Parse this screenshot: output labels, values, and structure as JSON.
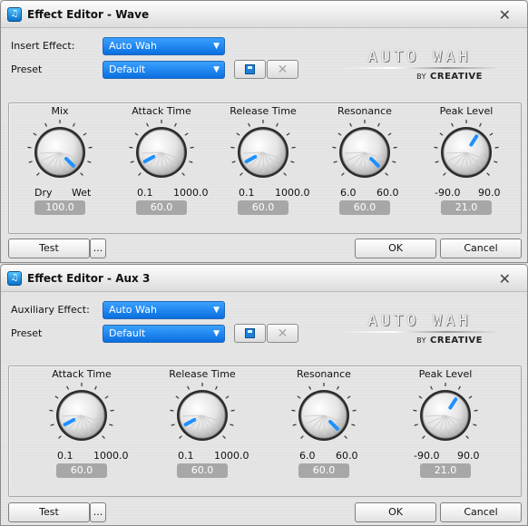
{
  "windows": [
    {
      "title": "Effect Editor - Wave",
      "effect_label": "Insert Effect:",
      "effect_value": "Auto Wah",
      "preset_label": "Preset",
      "preset_value": "Default",
      "logo": {
        "main": "AUTO WAH",
        "by": "BY",
        "brand": "CREATIVE"
      },
      "knobs": [
        {
          "label": "Mix",
          "min": "Dry",
          "max": "Wet",
          "value": "100.0",
          "fraction": 1.0
        },
        {
          "label": "Attack Time",
          "min": "0.1",
          "max": "1000.0",
          "value": "60.0",
          "fraction": 0.06
        },
        {
          "label": "Release Time",
          "min": "0.1",
          "max": "1000.0",
          "value": "60.0",
          "fraction": 0.06
        },
        {
          "label": "Resonance",
          "min": "6.0",
          "max": "60.0",
          "value": "60.0",
          "fraction": 1.0
        },
        {
          "label": "Peak Level",
          "min": "-90.0",
          "max": "90.0",
          "value": "21.0",
          "fraction": 0.62
        }
      ],
      "buttons": {
        "test": "Test",
        "more": "...",
        "ok": "OK",
        "cancel": "Cancel"
      },
      "close_symbol": "✕"
    },
    {
      "title": "Effect Editor - Aux 3",
      "effect_label": "Auxiliary Effect:",
      "effect_value": "Auto Wah",
      "preset_label": "Preset",
      "preset_value": "Default",
      "logo": {
        "main": "AUTO WAH",
        "by": "BY",
        "brand": "CREATIVE"
      },
      "knobs": [
        {
          "label": "Attack Time",
          "min": "0.1",
          "max": "1000.0",
          "value": "60.0",
          "fraction": 0.06
        },
        {
          "label": "Release Time",
          "min": "0.1",
          "max": "1000.0",
          "value": "60.0",
          "fraction": 0.06
        },
        {
          "label": "Resonance",
          "min": "6.0",
          "max": "60.0",
          "value": "60.0",
          "fraction": 1.0
        },
        {
          "label": "Peak Level",
          "min": "-90.0",
          "max": "90.0",
          "value": "21.0",
          "fraction": 0.62
        }
      ],
      "buttons": {
        "test": "Test",
        "more": "...",
        "ok": "OK",
        "cancel": "Cancel"
      },
      "close_symbol": "✕"
    }
  ],
  "colors": {
    "accent": "#0a6fe0",
    "indicator": "#1e90ff",
    "value_box": "#a7a7a7"
  },
  "icons": {
    "save": "save-icon",
    "delete": "delete-icon",
    "app": "effect-editor-icon",
    "dropdown": "chevron-down-icon"
  }
}
